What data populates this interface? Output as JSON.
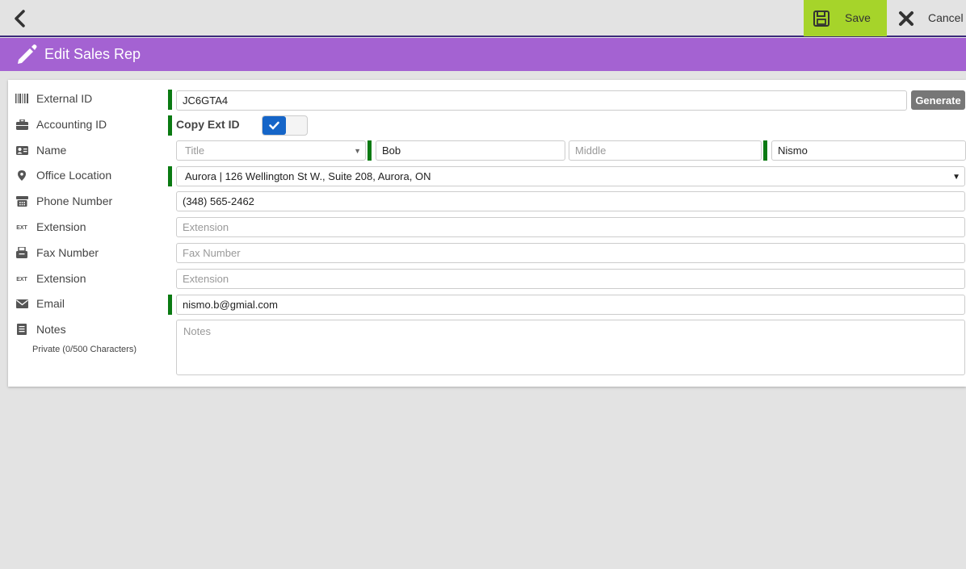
{
  "header": {
    "save_label": "Save",
    "cancel_label": "Cancel",
    "title": "Edit Sales Rep"
  },
  "colors": {
    "save_bg": "#a6d42a",
    "title_bg": "#a462d2",
    "required_bar": "#0a7a12",
    "toggle_on": "#1565c8"
  },
  "form": {
    "external_id": {
      "label": "External ID",
      "icon": "barcode-icon",
      "value": "JC6GTA4",
      "generate_label": "Generate"
    },
    "accounting_id": {
      "label": "Accounting ID",
      "icon": "briefcase-icon",
      "copy_label": "Copy Ext ID",
      "copy_checked": true
    },
    "name": {
      "label": "Name",
      "icon": "id-card-icon",
      "title_placeholder": "Title",
      "first_value": "Bob",
      "middle_placeholder": "Middle",
      "last_value": "Nismo"
    },
    "office_location": {
      "label": "Office Location",
      "icon": "map-marker-icon",
      "value": "Aurora | 126 Wellington St W., Suite 208, Aurora, ON"
    },
    "phone": {
      "label": "Phone Number",
      "icon": "phone-icon",
      "value": "(348) 565-2462"
    },
    "phone_ext": {
      "label": "Extension",
      "icon": "ext-icon",
      "icon_text": "EXT",
      "placeholder": "Extension"
    },
    "fax": {
      "label": "Fax Number",
      "icon": "fax-icon",
      "placeholder": "Fax Number"
    },
    "fax_ext": {
      "label": "Extension",
      "icon": "ext-icon",
      "icon_text": "EXT",
      "placeholder": "Extension"
    },
    "email": {
      "label": "Email",
      "icon": "envelope-icon",
      "value": "nismo.b@gmial.com"
    },
    "notes": {
      "label": "Notes",
      "icon": "document-icon",
      "sublabel": "Private (0/500 Characters)",
      "placeholder": "Notes"
    }
  }
}
